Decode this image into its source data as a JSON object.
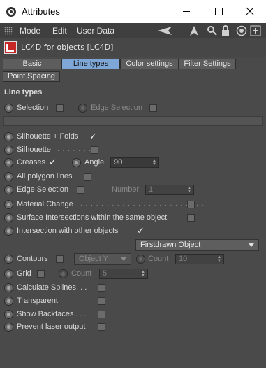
{
  "window": {
    "title": "Attributes",
    "min_glyph": "—",
    "max_glyph": "☐",
    "close_glyph": "✕"
  },
  "menu": {
    "mode": "Mode",
    "edit": "Edit",
    "user_data": "User Data"
  },
  "toolbar_icons": [
    "arrow-left-icon",
    "arrow-up-icon",
    "search-icon",
    "lock-icon",
    "target-icon",
    "add-icon"
  ],
  "object_header": {
    "label": "LC4D for objects [LC4D]"
  },
  "tabs": [
    "Basic",
    "Line types",
    "Color settings",
    "Filter Settings",
    "Point Spacing"
  ],
  "active_tab": "Line types",
  "section": {
    "title": "Line types"
  },
  "selection": {
    "label": "Selection",
    "edge_label": "Edge Selection"
  },
  "silhouette_folds": {
    "label": "Silhouette + Folds",
    "checked": "✓"
  },
  "silhouette": {
    "label": "Silhouette",
    "dots": ". . . . . . ."
  },
  "creases": {
    "label": "Creases",
    "checked": "✓",
    "angle_label": "Angle",
    "angle_value": "90"
  },
  "all_polygon_lines": {
    "label": "All polygon lines"
  },
  "edge_selection": {
    "label": "Edge Selection",
    "number_label": "Number",
    "number_value": "1"
  },
  "material_change": {
    "label": "Material Change",
    "dots": ". . . . . . . . . . . . . . . . . . . . . . . ."
  },
  "surface_intersections": {
    "label": "Surface Intersections within the same object"
  },
  "intersection_other": {
    "label": "Intersection with other objects",
    "checked": "✓"
  },
  "firstdrawn": {
    "value": "Firstdrawn Object"
  },
  "contours": {
    "label": "Contours",
    "axis_value": "Object Y",
    "count_label": "Count",
    "count_value": "10"
  },
  "grid": {
    "label": "Grid",
    "count_label": "Count",
    "count_value": "5"
  },
  "calculate_splines": {
    "label": "Calculate Splines. . ."
  },
  "transparent": {
    "label": "Transparent",
    "dots": ". . . . . . ."
  },
  "show_backfaces": {
    "label": "Show Backfaces . . ."
  },
  "prevent_laser": {
    "label": "Prevent laser output"
  },
  "colors": {
    "active_tab": "#7ea6d6",
    "panel": "#4a4a4a",
    "logo_red": "#c62828"
  }
}
